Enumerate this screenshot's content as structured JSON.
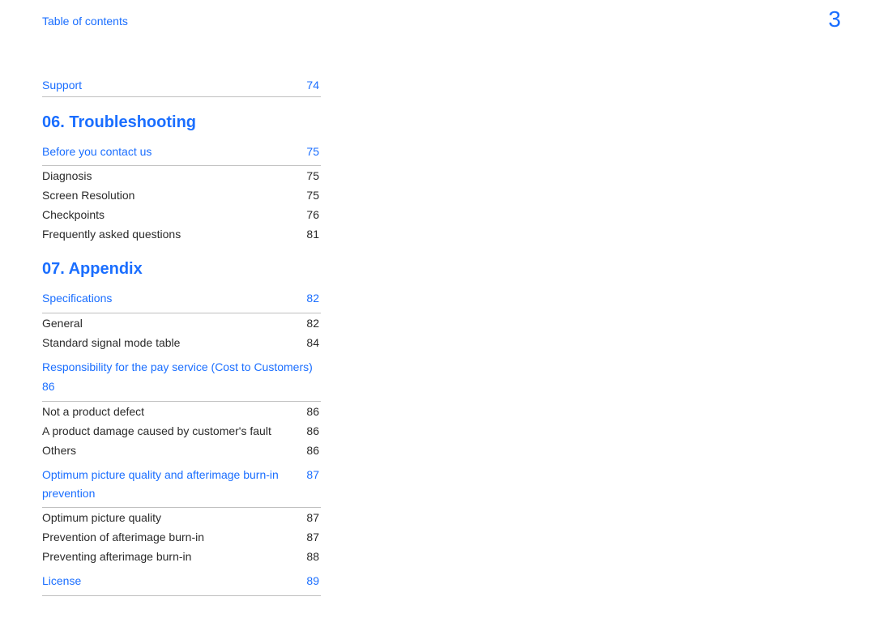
{
  "page_number": "3",
  "header": "Table of contents",
  "top_section": {
    "title": "Support",
    "page": "74"
  },
  "chapters": [
    {
      "heading": "06. Troubleshooting",
      "sections": [
        {
          "title": "Before you contact us",
          "page": "75",
          "multiline": false,
          "items": [
            {
              "title": "Diagnosis",
              "page": "75"
            },
            {
              "title": "Screen Resolution",
              "page": "75"
            },
            {
              "title": "Checkpoints",
              "page": "76"
            },
            {
              "title": "Frequently asked questions",
              "page": "81"
            }
          ]
        }
      ]
    },
    {
      "heading": "07.  Appendix",
      "sections": [
        {
          "title": "Specifications",
          "page": "82",
          "multiline": false,
          "items": [
            {
              "title": "General",
              "page": "82"
            },
            {
              "title": "Standard signal mode table",
              "page": "84"
            }
          ]
        },
        {
          "title": "Responsibility for the pay service (Cost to Customers)",
          "page": "86",
          "multiline": true,
          "items": [
            {
              "title": "Not a product defect",
              "page": "86"
            },
            {
              "title": "A product damage caused by customer's fault",
              "page": "86"
            },
            {
              "title": "Others",
              "page": "86"
            }
          ]
        },
        {
          "title": "Optimum picture quality and afterimage burn-in prevention",
          "page": "87",
          "multiline": false,
          "items": [
            {
              "title": "Optimum picture quality",
              "page": "87"
            },
            {
              "title": "Prevention of afterimage burn-in",
              "page": "87"
            },
            {
              "title": "Preventing afterimage burn-in",
              "page": "88"
            }
          ]
        },
        {
          "title": "License",
          "page": "89",
          "multiline": false,
          "last": true,
          "items": []
        }
      ]
    }
  ]
}
